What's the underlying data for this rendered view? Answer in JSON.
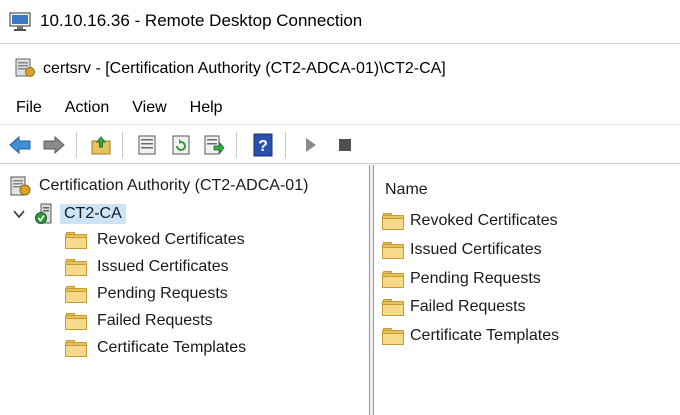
{
  "rdp": {
    "title": "10.10.16.36 - Remote Desktop Connection"
  },
  "mmc": {
    "title": "certsrv - [Certification Authority (CT2-ADCA-01)\\CT2-CA]"
  },
  "menu": [
    "File",
    "Action",
    "View",
    "Help"
  ],
  "toolbar": {
    "buttons": [
      "back-arrow-icon",
      "forward-arrow-icon",
      "up-folder-icon",
      "properties-icon",
      "refresh-icon",
      "export-list-icon",
      "help-icon",
      "start-service-icon",
      "stop-service-icon"
    ]
  },
  "tree": {
    "root": "Certification Authority (CT2-ADCA-01)",
    "ca": "CT2-CA",
    "children": [
      "Revoked Certificates",
      "Issued Certificates",
      "Pending Requests",
      "Failed Requests",
      "Certificate Templates"
    ]
  },
  "list": {
    "column": "Name",
    "items": [
      "Revoked Certificates",
      "Issued Certificates",
      "Pending Requests",
      "Failed Requests",
      "Certificate Templates"
    ]
  },
  "colors": {
    "selection": "#cce4f7",
    "folder": "#e8c25f",
    "help": "#2b4fb0",
    "back_arrow": "#3d8fd6"
  }
}
